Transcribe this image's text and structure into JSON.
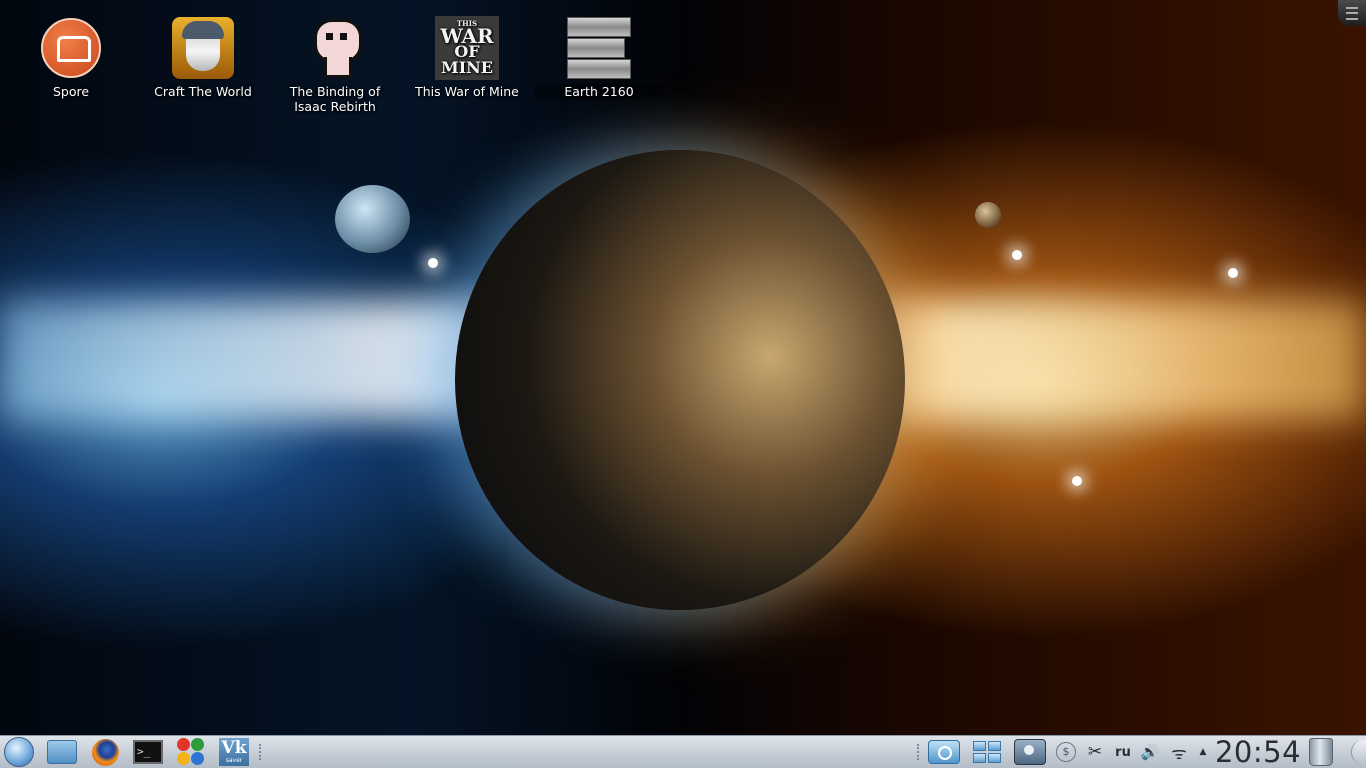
{
  "desktop": {
    "icons": [
      {
        "label": "Spore",
        "icon": "spore-icon"
      },
      {
        "label": "Craft The World",
        "icon": "craft-the-world-icon"
      },
      {
        "label": "The Binding of Isaac Rebirth",
        "icon": "binding-of-isaac-icon"
      },
      {
        "label": "This War of Mine",
        "icon": "this-war-of-mine-icon",
        "logo_text": [
          "THIS",
          "WAR",
          "OF MINE"
        ]
      },
      {
        "label": "Earth 2160",
        "icon": "earth-2160-icon"
      }
    ]
  },
  "panel": {
    "launchers": [
      {
        "icon": "application-menu-icon"
      },
      {
        "icon": "file-manager-icon"
      },
      {
        "icon": "firefox-icon"
      },
      {
        "icon": "terminal-icon",
        "glyph": ">_"
      },
      {
        "icon": "clover-app-icon"
      },
      {
        "icon": "vk-saver-icon",
        "glyph": "Vk",
        "sub": "saver"
      }
    ],
    "tray": {
      "keyboard_layout": "ru",
      "clock": "20:54",
      "icons": [
        "screenshot-camera-icon",
        "window-switcher-icon",
        "disk-utility-icon",
        "money-icon",
        "clipboard-scissors-icon",
        "volume-icon",
        "wifi-icon",
        "show-hidden-arrow-icon",
        "trash-icon"
      ],
      "glyphs": {
        "money": "$",
        "scissors": "✂",
        "volume": "🔊",
        "wifi": "ᯤ",
        "arrow": "▲"
      }
    }
  },
  "colors": {
    "panel_bg": "#c3cbd4",
    "clock_text": "#2a2d31",
    "wallpaper_left": "#041426",
    "wallpaper_right": "#3a1300"
  }
}
